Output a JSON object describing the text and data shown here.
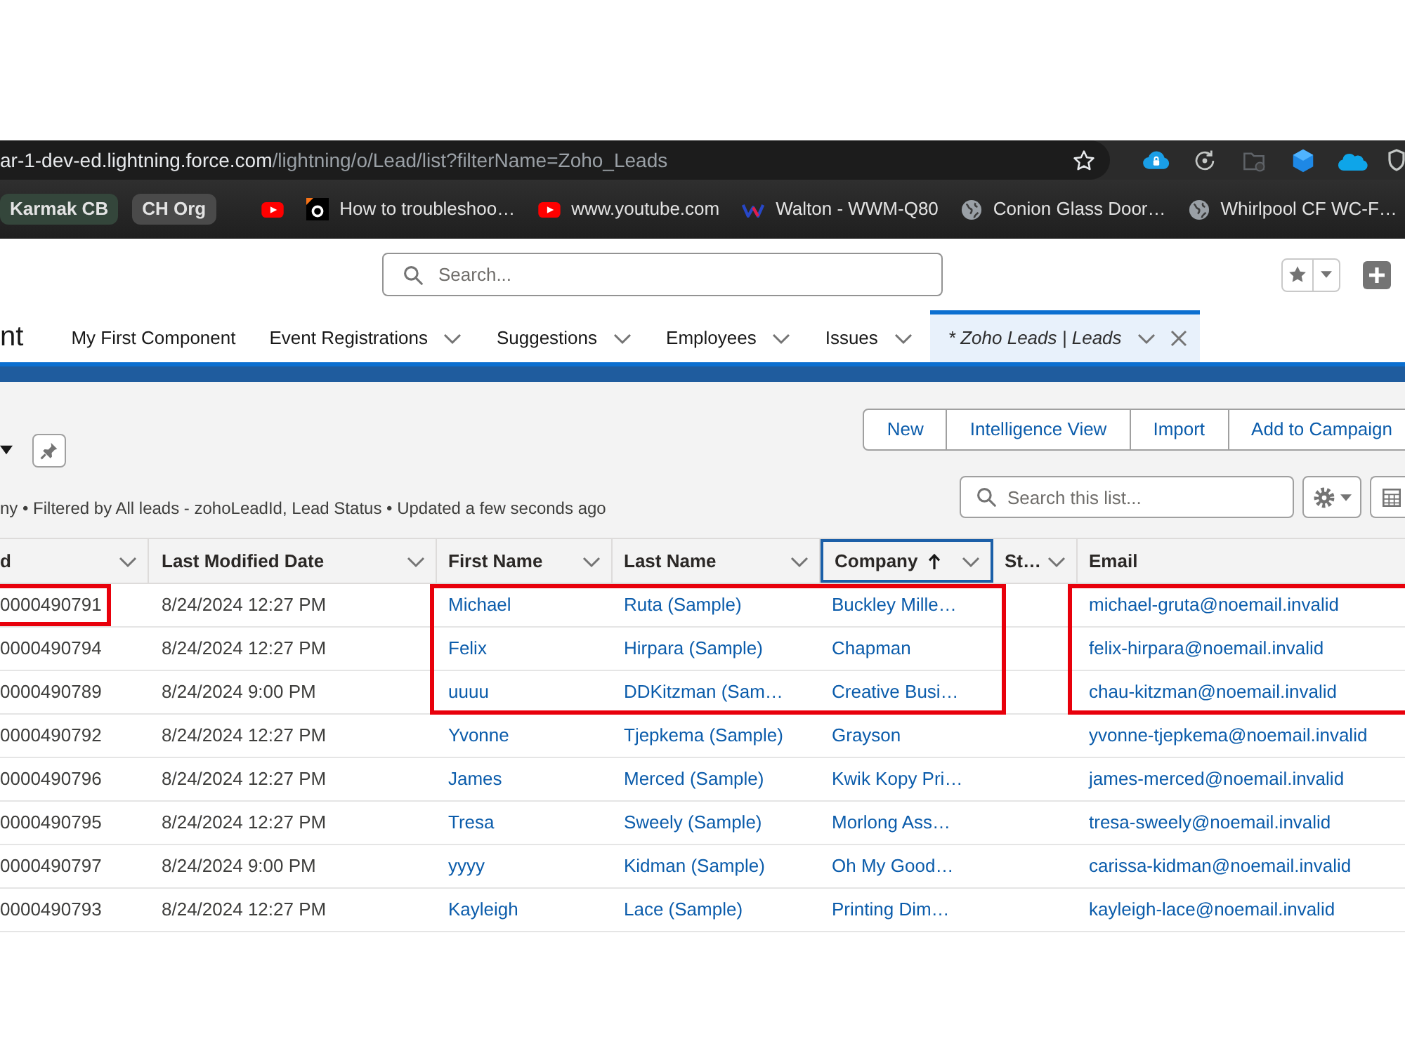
{
  "browser": {
    "url_host": "ar-1-dev-ed.lightning.force.com",
    "url_path": "/lightning/o/Lead/list?filterName=Zoho_Leads",
    "bookmarks": [
      {
        "kind": "group",
        "label": "Karmak CB",
        "color": "#34463b"
      },
      {
        "kind": "group",
        "label": "CH Org",
        "color": "#4a4a4a"
      },
      {
        "kind": "separator"
      },
      {
        "kind": "video"
      },
      {
        "kind": "site",
        "label": "How to troubleshoo…"
      },
      {
        "kind": "video",
        "label": "www.youtube.com"
      },
      {
        "kind": "brand",
        "label": "Walton - WWM-Q80"
      },
      {
        "kind": "globe",
        "label": "Conion Glass Door…"
      },
      {
        "kind": "globe",
        "label": "Whirlpool CF WC-F…"
      }
    ]
  },
  "header": {
    "search": {
      "placeholder": "Search..."
    }
  },
  "nav": {
    "app_name": "nt",
    "tabs": [
      {
        "label": "My First Component",
        "selected": false,
        "unsaved": false,
        "has_menu": false,
        "closable": false
      },
      {
        "label": "Event Registrations",
        "selected": false,
        "unsaved": false,
        "has_menu": true,
        "closable": false
      },
      {
        "label": "Suggestions",
        "selected": false,
        "unsaved": false,
        "has_menu": true,
        "closable": false
      },
      {
        "label": "Employees",
        "selected": false,
        "unsaved": false,
        "has_menu": true,
        "closable": false
      },
      {
        "label": "Issues",
        "selected": false,
        "unsaved": false,
        "has_menu": true,
        "closable": false
      },
      {
        "label": "* Zoho Leads | Leads",
        "selected": true,
        "unsaved": true,
        "has_menu": true,
        "closable": true
      }
    ]
  },
  "list_view": {
    "actions": [
      "New",
      "Intelligence View",
      "Import",
      "Add to Campaign"
    ],
    "info": "ny • Filtered by All leads - zohoLeadId, Lead Status • Updated a few seconds ago",
    "search": {
      "placeholder": "Search this list..."
    }
  },
  "table": {
    "columns": [
      {
        "label": "d",
        "kind": "text",
        "has_menu": true,
        "sorted": false,
        "focused": false
      },
      {
        "label": "Last Modified Date",
        "kind": "text",
        "has_menu": true,
        "sorted": false,
        "focused": false
      },
      {
        "label": "First Name",
        "kind": "link",
        "has_menu": true,
        "sorted": false,
        "focused": false
      },
      {
        "label": "Last Name",
        "kind": "link",
        "has_menu": true,
        "sorted": false,
        "focused": false
      },
      {
        "label": "Company",
        "kind": "link",
        "has_menu": true,
        "sorted": true,
        "focused": true
      },
      {
        "label": "St…",
        "has_menu": true,
        "sorted": false,
        "focused": false
      },
      {
        "label": "Email",
        "kind": "link",
        "has_menu": false,
        "sorted": false,
        "focused": false
      }
    ],
    "rows": [
      {
        "column_1": "0000490791",
        "last_modified_date": "8/24/2024 12:27 PM",
        "first_name": "Michael",
        "last_name": "Ruta (Sample)",
        "company": "Buckley Mille…",
        "email": "michael-gruta@noemail.invalid"
      },
      {
        "column_1": "0000490794",
        "last_modified_date": "8/24/2024 12:27 PM",
        "first_name": "Felix",
        "last_name": "Hirpara (Sample)",
        "company": "Chapman",
        "email": "felix-hirpara@noemail.invalid"
      },
      {
        "column_1": "0000490789",
        "last_modified_date": "8/24/2024 9:00 PM",
        "first_name": "uuuu",
        "last_name": "DDKitzman (Sam…",
        "company": "Creative Busi…",
        "email": "chau-kitzman@noemail.invalid"
      },
      {
        "column_1": "0000490792",
        "last_modified_date": "8/24/2024 12:27 PM",
        "first_name": "Yvonne",
        "last_name": "Tjepkema (Sample)",
        "company": "Grayson",
        "email": "yvonne-tjepkema@noemail.invalid"
      },
      {
        "column_1": "0000490796",
        "last_modified_date": "8/24/2024 12:27 PM",
        "first_name": "James",
        "last_name": "Merced (Sample)",
        "company": "Kwik Kopy Pri…",
        "email": "james-merced@noemail.invalid"
      },
      {
        "column_1": "0000490795",
        "last_modified_date": "8/24/2024 12:27 PM",
        "first_name": "Tresa",
        "last_name": "Sweely (Sample)",
        "company": "Morlong Ass…",
        "email": "tresa-sweely@noemail.invalid"
      },
      {
        "column_1": "0000490797",
        "last_modified_date": "8/24/2024 9:00 PM",
        "first_name": "yyyy",
        "last_name": "Kidman (Sample)",
        "company": "Oh My Good…",
        "email": "carissa-kidman@noemail.invalid"
      },
      {
        "column_1": "0000490793",
        "last_modified_date": "8/24/2024 12:27 PM",
        "first_name": "Kayleigh",
        "last_name": "Lace (Sample)",
        "company": "Printing Dim…",
        "email": "kayleigh-lace@noemail.invalid"
      }
    ]
  },
  "annotations": [
    {
      "kind": "id_cell"
    },
    {
      "kind": "name_company_block"
    },
    {
      "kind": "email_block"
    }
  ]
}
